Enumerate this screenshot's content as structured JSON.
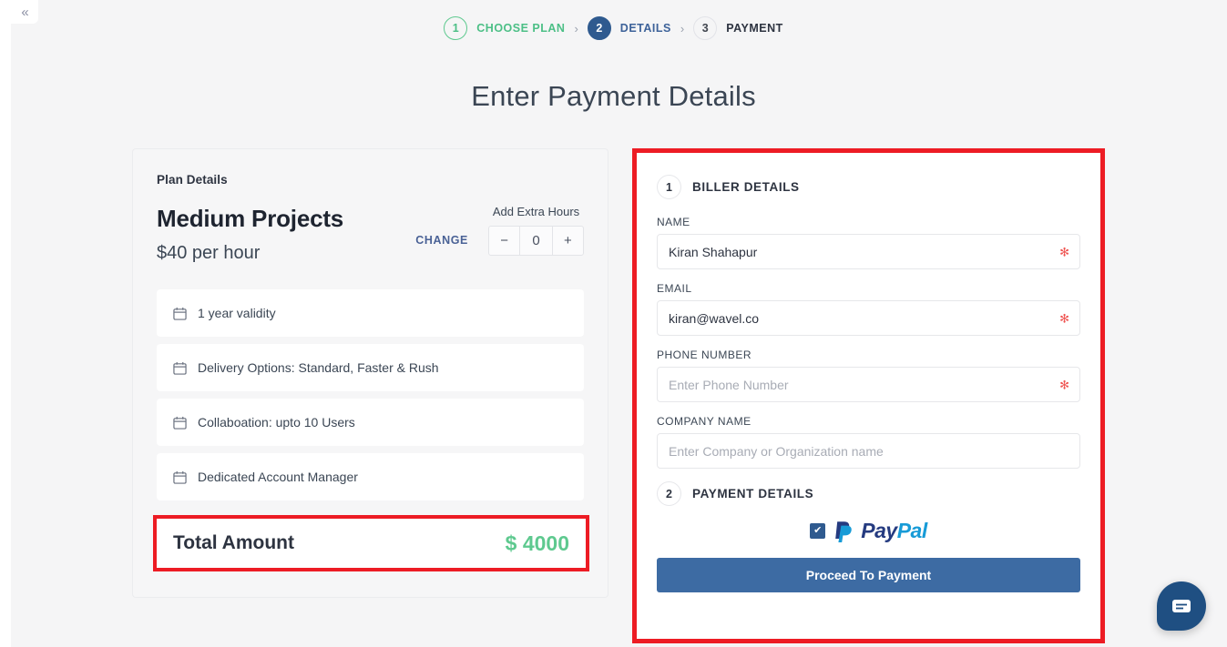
{
  "sidebar": {
    "collapse_icon": "double-chevron-left",
    "collapse_glyph": "«"
  },
  "stepper": {
    "steps": [
      {
        "num": "1",
        "label": "CHOOSE PLAN",
        "state": "done"
      },
      {
        "num": "2",
        "label": "DETAILS",
        "state": "active"
      },
      {
        "num": "3",
        "label": "PAYMENT",
        "state": "todo"
      }
    ],
    "separator": "›"
  },
  "page": {
    "title": "Enter Payment Details"
  },
  "plan": {
    "section_label": "Plan Details",
    "name": "Medium Projects",
    "price": "$40 per hour",
    "change_label": "CHANGE",
    "extra_hours_label": "Add Extra Hours",
    "extra_hours_value": "0",
    "minus_glyph": "−",
    "plus_glyph": "+",
    "features": [
      {
        "icon": "calendar-icon",
        "text": "1 year validity"
      },
      {
        "icon": "calendar-icon",
        "text": "Delivery Options: Standard, Faster & Rush"
      },
      {
        "icon": "calendar-icon",
        "text": "Collaboation: upto 10 Users"
      },
      {
        "icon": "calendar-icon",
        "text": "Dedicated Account Manager"
      }
    ],
    "total_label": "Total Amount",
    "total_value": "$ 4000"
  },
  "biller": {
    "step_num": "1",
    "title": "BILLER DETAILS",
    "fields": [
      {
        "label": "NAME",
        "value": "Kiran Shahapur",
        "placeholder": "",
        "required": true
      },
      {
        "label": "EMAIL",
        "value": "kiran@wavel.co",
        "placeholder": "",
        "required": true
      },
      {
        "label": "PHONE NUMBER",
        "value": "",
        "placeholder": "Enter Phone Number",
        "required": true
      },
      {
        "label": "COMPANY NAME",
        "value": "",
        "placeholder": "Enter Company or Organization name",
        "required": false
      }
    ],
    "required_star": "✻"
  },
  "payment": {
    "step_num": "2",
    "title": "PAYMENT DETAILS",
    "method": "PayPal",
    "method_pay": "Pay",
    "method_pal": "Pal",
    "checked": true,
    "check_glyph": "✔",
    "proceed_label": "Proceed To Payment"
  },
  "chat": {
    "icon": "chat-message-icon"
  },
  "colors": {
    "accent_blue": "#3d6ba3",
    "step_active": "#2f5a8f",
    "step_done_green": "#4cbf86",
    "total_green": "#5ec98f",
    "annotation_red": "#ed1c24",
    "required_red": "#ef5350",
    "paypal_dark": "#253b80",
    "paypal_light": "#179bd7"
  }
}
